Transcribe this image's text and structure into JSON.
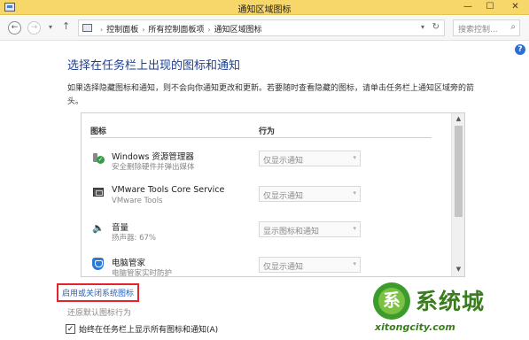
{
  "window": {
    "title": "通知区域图标",
    "minimize_glyph": "—",
    "maximize_glyph": "☐",
    "close_glyph": "✕"
  },
  "nav": {
    "back_glyph": "←",
    "forward_glyph": "→",
    "recent_glyph": "▾",
    "up_glyph": "↑",
    "breadcrumb": [
      "控制面板",
      "所有控制面板项",
      "通知区域图标"
    ],
    "separator": "›",
    "dropdown_glyph": "▾",
    "refresh_glyph": "↻",
    "search_placeholder": "搜索控制...",
    "search_glyph": "⌕"
  },
  "help_glyph": "?",
  "heading": "选择在任务栏上出现的图标和通知",
  "description": "如果选择隐藏图标和通知，则不会向你通知更改和更新。若要随时查看隐藏的图标，请单击任务栏上通知区域旁的箭头。",
  "table": {
    "col_icon": "图标",
    "col_behavior": "行为",
    "rows": [
      {
        "icon": "usb-safely-remove-icon",
        "name": "Windows 资源管理器",
        "sub": "安全删除硬件并弹出媒体",
        "behavior": "仅显示通知"
      },
      {
        "icon": "vmware-tools-icon",
        "name": "VMware Tools Core Service",
        "sub": "VMware Tools",
        "behavior": "仅显示通知"
      },
      {
        "icon": "speaker-icon",
        "name": "音量",
        "sub": "扬声器: 67%",
        "behavior": "显示图标和通知"
      },
      {
        "icon": "tencent-pc-manager-icon",
        "name": "电脑管家",
        "sub": "电脑管家实时防护",
        "behavior": "仅显示通知"
      }
    ],
    "select_arrow": "▾",
    "scroll_up": "▲",
    "scroll_down": "▼"
  },
  "links": {
    "system_icons": "启用或关闭系统图标",
    "restore": "还原默认图标行为"
  },
  "checkbox": {
    "label": "始终在任务栏上显示所有图标和通知(A)",
    "mark": "✓"
  },
  "watermark": {
    "logo_char": "系",
    "big_text": "系统城",
    "small_text": "xitongcity.com"
  },
  "colors": {
    "title_bar": "#f7d66a",
    "heading": "#1e3f8f",
    "link": "#2a62b8",
    "highlight_border": "#e5232d",
    "watermark_green": "#3a7d1e"
  }
}
